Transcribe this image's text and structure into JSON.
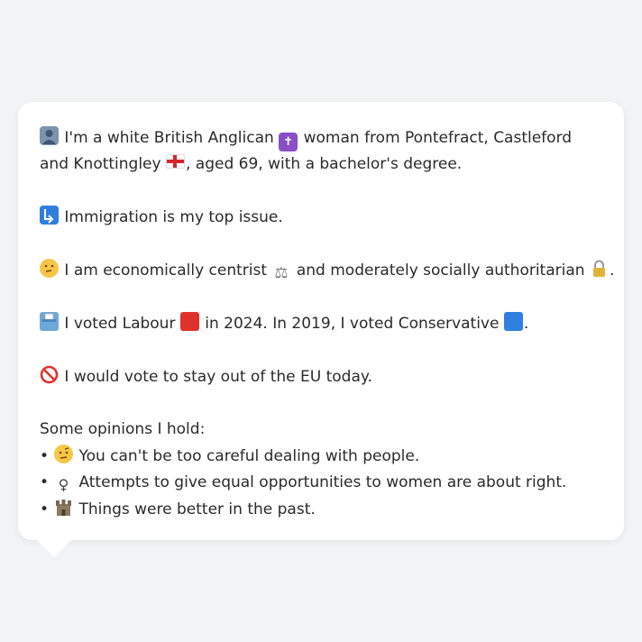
{
  "profile": {
    "identity_line_1": "I'm a white British Anglican",
    "identity_line_2": "woman from Pontefract, Castleford and",
    "identity_line_3": "Knottingley",
    "identity_line_4": ", aged 69, with a bachelor's degree.",
    "top_issue": "Immigration is my top issue.",
    "politics_part_1": "I am economically centrist",
    "politics_part_2": "and moderately socially authoritarian",
    "politics_part_3": ".",
    "vote_part_1": "I voted Labour",
    "vote_part_2": "in 2024. In 2019, I voted Conservative",
    "vote_part_3": ".",
    "eu": "I would vote to stay out of the EU today.",
    "opinions_heading": "Some opinions I hold:",
    "opinions": [
      "You can't be too careful dealing with people.",
      "Attempts to give equal opportunities to women are about right.",
      "Things were better in the past."
    ],
    "bullet": "•"
  },
  "icons": {
    "identity": "person-silhouette-icon",
    "religion": "latin-cross-icon",
    "region": "england-flag-icon",
    "issue": "immigration-icon",
    "politics": "thinking-face-icon",
    "economic": "balance-scale-icon",
    "social": "locked-padlock-icon",
    "vote": "ballot-box-icon",
    "labour": "red-square-icon",
    "conservative": "blue-square-icon",
    "eu": "no-entry-icon",
    "opinion_1": "face-with-raised-eyebrow-icon",
    "opinion_2": "female-sign-icon",
    "opinion_3": "castle-icon"
  },
  "colors": {
    "background": "#f2f3f5",
    "bubble": "#ffffff",
    "text": "#2a2a2a",
    "labour_red": "#e0322d",
    "conservative_blue": "#2f7ee0"
  }
}
